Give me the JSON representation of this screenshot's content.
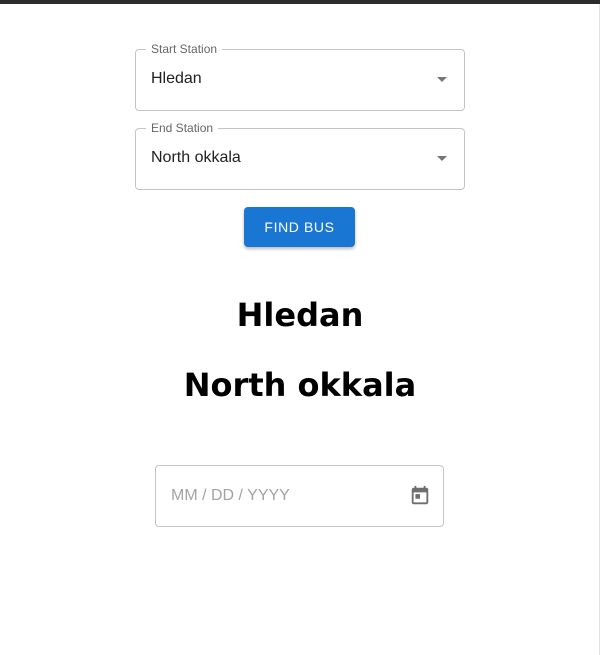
{
  "form": {
    "start_station": {
      "label": "Start Station",
      "value": "Hledan"
    },
    "end_station": {
      "label": "End Station",
      "value": "North okkala"
    },
    "find_button_label": "FIND BUS"
  },
  "results": {
    "start_heading": "Hledan",
    "end_heading": "North okkala"
  },
  "date_picker": {
    "placeholder": "MM / DD / YYYY",
    "icon": "calendar-icon"
  },
  "colors": {
    "accent": "#1976d2",
    "border": "#c4c4c4",
    "top_bar": "#2b2b2b"
  }
}
